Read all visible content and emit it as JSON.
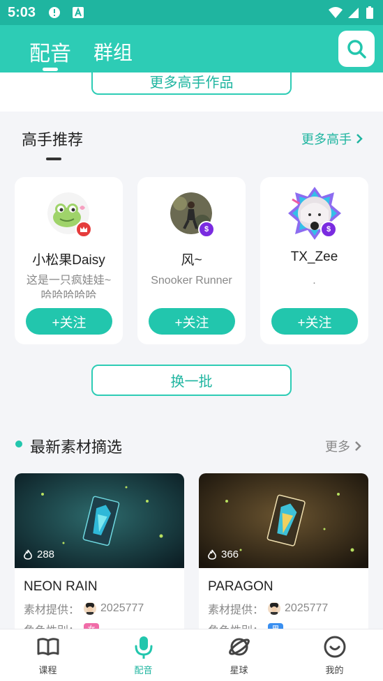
{
  "status_bar": {
    "time": "5:03"
  },
  "header": {
    "tabs": [
      {
        "label": "配音",
        "active": true
      },
      {
        "label": "群组",
        "active": false
      }
    ],
    "search_icon": "search-icon"
  },
  "top_section": {
    "more_works_label": "更多高手作品"
  },
  "experts": {
    "title": "高手推荐",
    "more_label": "更多高手",
    "cards": [
      {
        "name": "小松果Daisy",
        "desc": "这是一只疯娃娃~哈哈哈哈哈",
        "follow_label": "+关注",
        "badge": "crown"
      },
      {
        "name": "风~",
        "desc": "Snooker Runner",
        "follow_label": "+关注",
        "badge": "$"
      },
      {
        "name": "TX_Zee",
        "desc": ".",
        "follow_label": "+关注",
        "badge": "$"
      }
    ],
    "refresh_label": "换一批"
  },
  "materials": {
    "title": "最新素材摘选",
    "more_label": "更多",
    "items": [
      {
        "title": "NEON RAIN",
        "count": "288",
        "provider_label": "素材提供：",
        "provider": "2025777",
        "gender_label": "角色性别：",
        "gender": "女",
        "gender_color": "#f06ca8"
      },
      {
        "title": "PARAGON",
        "count": "366",
        "provider_label": "素材提供：",
        "provider": "2025777",
        "gender_label": "角色性别：",
        "gender": "男",
        "gender_color": "#3a8ff0"
      }
    ]
  },
  "bottom_nav": [
    {
      "label": "课程",
      "icon": "book-icon",
      "active": false
    },
    {
      "label": "配音",
      "icon": "microphone-icon",
      "active": true
    },
    {
      "label": "星球",
      "icon": "planet-icon",
      "active": false
    },
    {
      "label": "我的",
      "icon": "smiley-icon",
      "active": false
    }
  ],
  "colors": {
    "accent": "#2dccb5",
    "accent_dark": "#1fb5a0"
  }
}
